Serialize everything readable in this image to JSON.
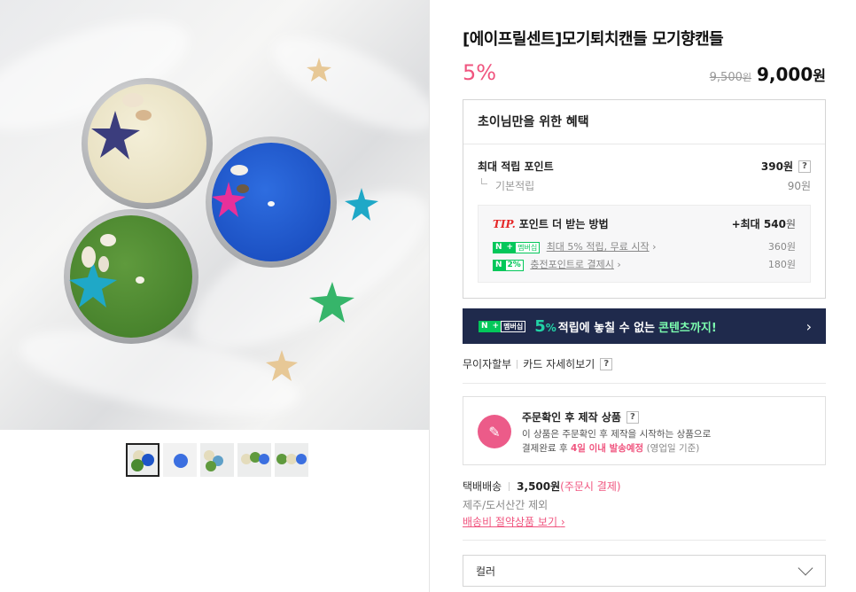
{
  "product": {
    "title": "[에이프릴센트]모기퇴치캔들 모기향캔들",
    "discount": "5%",
    "original_price": "9,500",
    "original_price_unit": "원",
    "sale_price": "9,000",
    "sale_price_unit": "원"
  },
  "gallery": {
    "thumbnail_count": 5,
    "active_index": 0
  },
  "benefits": {
    "heading": "초이님만을 위한 혜택",
    "max_points_label": "최대 적립 포인트",
    "max_points_value": "390원",
    "base_points_label": "기본적립",
    "base_points_value": "90원",
    "tip": {
      "tip_label": "TIP.",
      "title": "포인트 더 받는 방법",
      "max_prefix": "+최대 540",
      "max_unit": "원",
      "membership_badge": "멤버십",
      "membership_text": "최대 5% 적립, 무료 시작",
      "membership_value": "360원",
      "charge_badge": "2%",
      "charge_text": "충전포인트로 결제시",
      "charge_value": "180원"
    }
  },
  "banner": {
    "badge": "멤버십",
    "big_number": "5",
    "big_unit": "%",
    "text": "적립에 놓칠 수 없는",
    "highlight": "콘텐츠까지!",
    "arrow": "›"
  },
  "payment": {
    "installment": "무이자할부",
    "card_details": "카드 자세히보기"
  },
  "notice": {
    "title": "주문확인 후 제작 상품",
    "line1": "이 상품은 주문확인 후 제작을 시작하는 상품으로",
    "line2_prefix": "결제완료 후",
    "line2_highlight": "4일 이내 발송예정",
    "line2_suffix": "(영업일 기준)"
  },
  "shipping": {
    "method": "택배배송",
    "fee": "3,500원",
    "fee_note": "(주문시 결제)",
    "exclusion": "제주/도서산간 제외",
    "link": "배송비 절약상품 보기"
  },
  "option": {
    "label": "컬러"
  },
  "colors": {
    "accent_pink": "#f0557f",
    "naver_green": "#03c75a",
    "banner_navy": "#1f2a4c"
  }
}
